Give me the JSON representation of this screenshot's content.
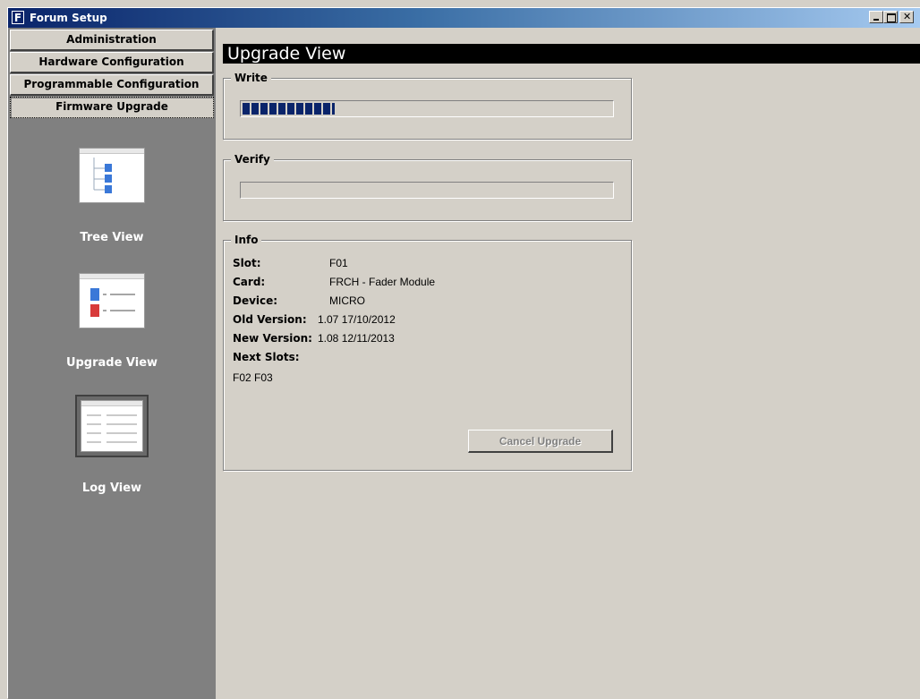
{
  "window": {
    "title": "Forum Setup",
    "app_icon_letter": "F"
  },
  "sidebar": {
    "tabs": [
      {
        "label": "Administration"
      },
      {
        "label": "Hardware Configuration"
      },
      {
        "label": "Programmable Configuration"
      },
      {
        "label": "Firmware Upgrade"
      }
    ],
    "views": [
      {
        "label": "Tree View",
        "icon": "tree-view-icon"
      },
      {
        "label": "Upgrade View",
        "icon": "upgrade-view-icon"
      },
      {
        "label": "Log View",
        "icon": "log-view-icon"
      }
    ]
  },
  "main": {
    "header": "Upgrade View",
    "write": {
      "label": "Write",
      "progress": 0.25
    },
    "verify": {
      "label": "Verify",
      "progress": 0.0
    },
    "info": {
      "label": "Info",
      "slot_key": "Slot:",
      "slot_value": "F01",
      "card_key": "Card:",
      "card_value": "FRCH - Fader Module",
      "device_key": "Device:",
      "device_value": "MICRO",
      "old_version_key": "Old Version:",
      "old_version_value": "1.07 17/10/2012",
      "new_version_key": "New Version:",
      "new_version_value": "1.08 12/11/2013",
      "next_slots_key": "Next Slots:",
      "next_slots_value": "F02 F03",
      "cancel_label": "Cancel Upgrade"
    }
  },
  "colors": {
    "progress": "#0a246a",
    "sidebar_bg": "#808080",
    "panel_bg": "#d4d0c8",
    "header_bg": "#000000"
  }
}
